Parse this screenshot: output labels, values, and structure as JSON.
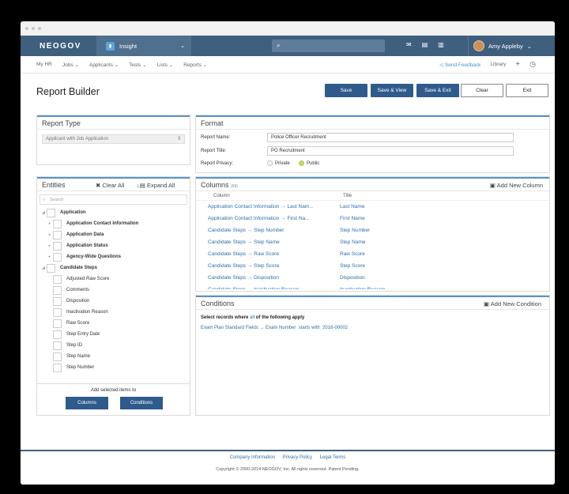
{
  "topbar": {
    "brand": "NEOGOV",
    "app_name": "Insight",
    "search_placeholder": "",
    "user_name": "Amy Appleby"
  },
  "subnav": {
    "items": [
      "My HR",
      "Jobs",
      "Applicants",
      "Tests",
      "Lists",
      "Reports"
    ],
    "send_feedback": "Send Feedback",
    "library": "Library"
  },
  "page": {
    "title": "Report Builder",
    "buttons": {
      "save": "Save",
      "save_view": "Save & View",
      "save_exit": "Save & Exit",
      "clear": "Clear",
      "exit": "Exit"
    }
  },
  "report_type": {
    "heading": "Report Type",
    "selected": "Applicant with Job Application"
  },
  "format": {
    "heading": "Format",
    "name_label": "Report Name:",
    "name_value": "Police Officer Recruitment",
    "title_label": "Report Title:",
    "title_value": "PO Recruitment",
    "privacy_label": "Report Privacy:",
    "private_label": "Private",
    "public_label": "Public"
  },
  "entities": {
    "heading": "Entities",
    "clear_all": "Clear All",
    "expand_all": "Expand All",
    "search_placeholder": "Search",
    "tree": [
      {
        "label": "Application",
        "bold": true,
        "level": 0,
        "arrow": "◢"
      },
      {
        "label": "Application Contact Information",
        "bold": true,
        "level": 1,
        "arrow": "▸"
      },
      {
        "label": "Application Data",
        "bold": true,
        "level": 1,
        "arrow": "▸"
      },
      {
        "label": "Application Status",
        "bold": true,
        "level": 1,
        "arrow": "▸"
      },
      {
        "label": "Agency-Wide Questions",
        "bold": true,
        "level": 1,
        "arrow": "▸"
      },
      {
        "label": "Candidate Steps",
        "bold": true,
        "level": 0,
        "arrow": "◢"
      },
      {
        "label": "Adjusted Raw Score",
        "bold": false,
        "level": 1,
        "arrow": ""
      },
      {
        "label": "Comments",
        "bold": false,
        "level": 1,
        "arrow": ""
      },
      {
        "label": "Disposition",
        "bold": false,
        "level": 1,
        "arrow": ""
      },
      {
        "label": "Inactivation Reason",
        "bold": false,
        "level": 1,
        "arrow": ""
      },
      {
        "label": "Raw Score",
        "bold": false,
        "level": 1,
        "arrow": ""
      },
      {
        "label": "Step Entry Date",
        "bold": false,
        "level": 1,
        "arrow": ""
      },
      {
        "label": "Step ID",
        "bold": false,
        "level": 1,
        "arrow": ""
      },
      {
        "label": "Step Name",
        "bold": false,
        "level": 1,
        "arrow": ""
      },
      {
        "label": "Step Number",
        "bold": false,
        "level": 1,
        "arrow": ""
      }
    ],
    "add_label": "Add selected items to",
    "columns_btn": "Columns",
    "conditions_btn": "Conditions"
  },
  "columns": {
    "heading": "Columns",
    "count": "(69)",
    "add_new": "Add New Column",
    "col_header": "Column",
    "title_header": "Title",
    "rows": [
      {
        "column": "Application Contact Information → Last Nam...",
        "title": "Last Name"
      },
      {
        "column": "Application Contact Information → First Na...",
        "title": "First Name"
      },
      {
        "column": "Candidate Steps → Step Number",
        "title": "Step Number"
      },
      {
        "column": "Candidate Steps → Step Name",
        "title": "Step Name"
      },
      {
        "column": "Candidate Steps → Raw Score",
        "title": "Raw Score"
      },
      {
        "column": "Candidate Steps → Step Score",
        "title": "Step Score"
      },
      {
        "column": "Candidate Steps → Disposition",
        "title": "Disposition"
      },
      {
        "column": "Candidate Steps → Inactivation Reason",
        "title": "Inactivation Reason"
      }
    ]
  },
  "conditions": {
    "heading": "Conditions",
    "add_new": "Add New Condition",
    "select_prefix": "Select records where",
    "select_mode": "all",
    "select_suffix": "of the following apply",
    "rule": "Exam Plan Standard Fields → Exam Number",
    "operator": "starts with",
    "value": "2016-00002"
  },
  "footer": {
    "links": [
      "Company Information",
      "Privacy Policy",
      "Legal Terms"
    ],
    "copyright": "Copyright © 2000-2014 NEOGOV, Inc. All rights reserved. Patent Pending."
  },
  "colors": {
    "nav": "#3e5f7e",
    "primary_button": "#2f5b8c",
    "accent": "#5a93c5",
    "link": "#2f6ea8"
  }
}
